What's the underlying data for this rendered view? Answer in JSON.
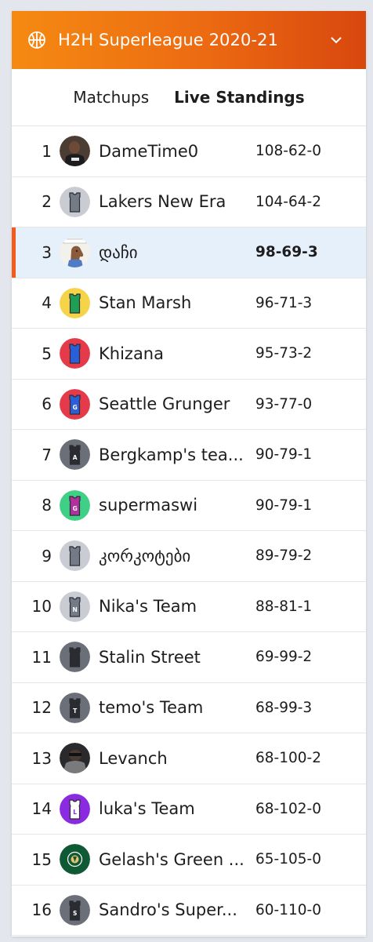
{
  "header": {
    "title": "H2H Superleague 2020-21",
    "icon": "basketball-icon",
    "dropdown_icon": "chevron-down-icon",
    "gradient": [
      "#f58a12",
      "#d8470e"
    ]
  },
  "tabs": [
    {
      "label": "Matchups",
      "active": false
    },
    {
      "label": "Live Standings",
      "active": true
    }
  ],
  "highlight_color": "#f25a1e",
  "standings": [
    {
      "rank": "1",
      "team": "DameTime0",
      "record": "108-62-0",
      "avatar": "photo"
    },
    {
      "rank": "2",
      "team": "Lakers New Era",
      "record": "104-64-2",
      "avatar": "jersey",
      "bg": "#c9ccd3",
      "jersey": "#747a86",
      "letter": ""
    },
    {
      "rank": "3",
      "team": "დაჩი",
      "record": "98-69-3",
      "avatar": "cartoon",
      "mine": true
    },
    {
      "rank": "4",
      "team": "Stan Marsh",
      "record": "96-71-3",
      "avatar": "jersey",
      "bg": "#f6d44a",
      "jersey": "#1f9e55",
      "letter": ""
    },
    {
      "rank": "5",
      "team": "Khizana",
      "record": "95-73-2",
      "avatar": "jersey",
      "bg": "#e53a4a",
      "jersey": "#2a5fd9",
      "letter": ""
    },
    {
      "rank": "6",
      "team": "Seattle Grunger",
      "record": "93-77-0",
      "avatar": "jersey",
      "bg": "#e53a4a",
      "jersey": "#2a5fd9",
      "letter": "G"
    },
    {
      "rank": "7",
      "team": "Bergkamp's tea...",
      "record": "90-79-1",
      "avatar": "jersey",
      "bg": "#6b6f78",
      "jersey": "#2a2c31",
      "letter": "A"
    },
    {
      "rank": "8",
      "team": "supermaswi",
      "record": "90-79-1",
      "avatar": "jersey",
      "bg": "#3fcf86",
      "jersey": "#b0309e",
      "letter": "G"
    },
    {
      "rank": "9",
      "team": "კორკოტები",
      "record": "89-79-2",
      "avatar": "jersey",
      "bg": "#c9ccd3",
      "jersey": "#747a86",
      "letter": ""
    },
    {
      "rank": "10",
      "team": "Nika's Team",
      "record": "88-81-1",
      "avatar": "jersey",
      "bg": "#c9ccd3",
      "jersey": "#747a86",
      "letter": "N"
    },
    {
      "rank": "11",
      "team": "Stalin Street",
      "record": "69-99-2",
      "avatar": "jersey",
      "bg": "#6b6f78",
      "jersey": "#2a2c31",
      "letter": ""
    },
    {
      "rank": "12",
      "team": "temo's Team",
      "record": "68-99-3",
      "avatar": "jersey",
      "bg": "#6b6f78",
      "jersey": "#2a2c31",
      "letter": "T"
    },
    {
      "rank": "13",
      "team": "Levanch",
      "record": "68-100-2",
      "avatar": "photo-dark"
    },
    {
      "rank": "14",
      "team": "luka's Team",
      "record": "68-102-0",
      "avatar": "jersey",
      "bg": "#8a2be2",
      "jersey": "#ffffff",
      "letter": "L"
    },
    {
      "rank": "15",
      "team": "Gelash's Green ...",
      "record": "65-105-0",
      "avatar": "celtics"
    },
    {
      "rank": "16",
      "team": "Sandro's Super...",
      "record": "60-110-0",
      "avatar": "jersey",
      "bg": "#6b6f78",
      "jersey": "#2a2c31",
      "letter": "S"
    }
  ]
}
